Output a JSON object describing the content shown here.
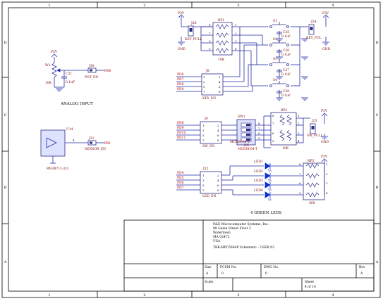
{
  "colors": {
    "frame": "#000000",
    "wire": "#1f2aa8",
    "part": "#2b2b8a",
    "net_label": "#b00000",
    "ref": "#7a0000",
    "led": "#1030d0",
    "box_fill": "#dde3ff"
  },
  "border": {
    "cols": [
      "1",
      "2",
      "3",
      "4"
    ],
    "rows": [
      "D",
      "C",
      "B",
      "A"
    ]
  },
  "keys_block": {
    "power_left": "P3V",
    "power_right": "P3V",
    "gnd_left": "GND",
    "gnd_right": "GND",
    "jp_left_ref": "J26",
    "jp_left_label": "KEY_PULL",
    "jp_right_ref": "J24",
    "jp_right_label": "KEY_PUL",
    "rp_ref": "RP1",
    "rp_value": "10K",
    "rp_pins_left": [
      "8",
      "7",
      "6",
      "5"
    ],
    "rp_pins_right": [
      "1",
      "2",
      "3",
      "4"
    ],
    "switches": [
      {
        "ref": "S1",
        "cap": "C25",
        "cval": "0.1uF"
      },
      {
        "ref": "S2",
        "cap": "C26",
        "cval": "0.1uF"
      },
      {
        "ref": "S3",
        "cap": "C27",
        "cval": "0.1uF"
      },
      {
        "ref": "S4",
        "cap": "C28",
        "cval": "0.1uF"
      }
    ],
    "header_ref": "J8",
    "header_label": "KEY_EN",
    "header_pins_left": [
      "1",
      "3",
      "5",
      "7"
    ],
    "header_pins_right": [
      "2",
      "4",
      "6",
      "8"
    ],
    "nets": [
      "PD6",
      "PD7",
      "PD8",
      "PD9"
    ]
  },
  "pot_block": {
    "power": "P3V",
    "pot_ref": "W1",
    "pot_value": "10K",
    "cap_ref": "C21",
    "cap_value": "0.1uF",
    "jp_ref": "J30",
    "jp_label": "POT_EN",
    "net": "PB8",
    "title": "ANALOG INPUT"
  },
  "sensor_block": {
    "u_ref": "U14",
    "u_part": "BN3B711-2/3",
    "pin": "4",
    "jp_ref": "J31",
    "jp_label": "SENSOR_EN",
    "net": "PB1"
  },
  "sw_block": {
    "header_ref": "J9",
    "header_label": "SW_EN",
    "header_pins_left": [
      "1",
      "3",
      "5",
      "7"
    ],
    "header_pins_right": [
      "2",
      "4",
      "6",
      "8"
    ],
    "nets": [
      "PD8",
      "PD9",
      "PD10",
      "PD11"
    ],
    "dip_ref": "SW1",
    "dip_part": "MCDM-04-T",
    "dip_part2": "MCDM-04-T",
    "dip_label": "DS",
    "dip_pins_right": [
      "8",
      "7",
      "6",
      "5"
    ],
    "rp_ref": "RP2",
    "rp_value": "10K",
    "rp_pins_left": [
      "8",
      "7",
      "6",
      "5"
    ],
    "rp_pins_right": [
      "1",
      "2",
      "3",
      "4"
    ],
    "power": "P3V",
    "gnd": "GND",
    "jp_ref": "J25",
    "jp_label": "SW_PULL"
  },
  "led_block": {
    "header_ref": "J12",
    "header_label": "LED_EN",
    "header_pins_left": [
      "1",
      "3",
      "5",
      "7"
    ],
    "header_pins_right": [
      "2",
      "4",
      "6",
      "8"
    ],
    "nets": [
      "PD4",
      "PD5",
      "PD6",
      "PD7"
    ],
    "leds": [
      "LED1",
      "LED2",
      "LED3",
      "LED4"
    ],
    "rp_ref": "RP3",
    "rp_value": "560",
    "rp_pins_left": [
      "8",
      "7",
      "6",
      "5"
    ],
    "rp_pins_right": [
      "1",
      "2",
      "3",
      "4"
    ],
    "power": "P3V",
    "title": "4 GREEN LEDS"
  },
  "title_block": {
    "company": "P&E Microcomputer Systems, Inc.",
    "addr1": "98 Galen Street Floor 2",
    "addr2": "Watertown",
    "addr3": "MA 02472",
    "addr4": "USA",
    "doc_title": "TRK-MPC5604P Schematic - USER IO",
    "size_label": "Size",
    "size_value": "A",
    "fcsm_label": "FCSM No.",
    "fcsm_value": "0",
    "dwg_label": "DWG No.",
    "dwg_value": "0",
    "rev_label": "Rev",
    "rev_value": "A",
    "scale_label": "Scale",
    "sheet_label": "Sheet",
    "sheet_value": "4 of 10"
  }
}
